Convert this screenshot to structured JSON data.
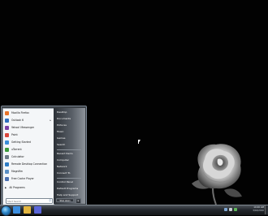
{
  "start_menu": {
    "programs": [
      {
        "label": "Mozilla Firefox",
        "icon": "firefox-icon",
        "color": "#e8742a",
        "has_arrow": false
      },
      {
        "label": "Outlook 6",
        "icon": "outlook-icon",
        "color": "#2f6fbf",
        "has_arrow": true
      },
      {
        "label": "Yahoo! Messenger",
        "icon": "messenger-icon",
        "color": "#7b3fa7",
        "has_arrow": false
      },
      {
        "label": "Paint",
        "icon": "paint-icon",
        "color": "#d9463b",
        "has_arrow": false
      },
      {
        "label": "Getting Started",
        "icon": "getting-started-icon",
        "color": "#3b8ed8",
        "has_arrow": false
      },
      {
        "label": "uTorrent",
        "icon": "utorrent-icon",
        "color": "#3a9b3a",
        "has_arrow": false
      },
      {
        "label": "Calculator",
        "icon": "calculator-icon",
        "color": "#6c7a86",
        "has_arrow": false
      },
      {
        "label": "Remote Desktop Connection",
        "icon": "remote-desktop-icon",
        "color": "#2e7cc4",
        "has_arrow": false
      },
      {
        "label": "Magnifier",
        "icon": "magnifier-icon",
        "color": "#5a8fc4",
        "has_arrow": false
      },
      {
        "label": "Free Cache Player",
        "icon": "player-icon",
        "color": "#4a6fb0",
        "has_arrow": false
      }
    ],
    "all_programs_label": "All Programs",
    "search_placeholder": "Start Search",
    "right_items": [
      "Desktop",
      "Documents",
      "Pictures",
      "Music",
      "Games",
      "Search",
      "Recent Items",
      "Computer",
      "Network",
      "Connect To",
      "Control Panel",
      "Default Programs",
      "Help and Support"
    ],
    "shutdown_label": "Shut down"
  },
  "taskbar": {
    "quick_launch": [
      {
        "icon": "internet-explorer-icon",
        "color": "#3d8fe0"
      },
      {
        "icon": "windows-explorer-icon",
        "color": "#e2b540"
      },
      {
        "icon": "media-player-icon",
        "color": "#5a66d8"
      }
    ],
    "clock_time": "10:26 AM",
    "clock_date": "3/16/2010"
  }
}
